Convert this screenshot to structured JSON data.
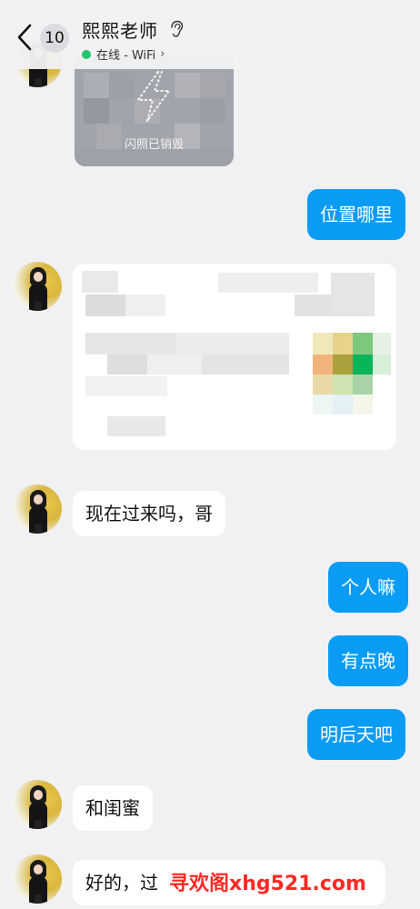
{
  "header": {
    "unread_count": "10",
    "contact_name": "熙熙老师",
    "status": "在线 - WiFi",
    "status_chevron": "›",
    "ear_icon": "ear-icon"
  },
  "flash_photo": {
    "label": "闪照已销毁"
  },
  "messages": [
    {
      "side": "out",
      "text": "位置哪里"
    },
    {
      "side": "in",
      "text": "现在过来吗，哥"
    },
    {
      "side": "out",
      "text": "个人嘛"
    },
    {
      "side": "out",
      "text": "有点晚"
    },
    {
      "side": "out",
      "text": "明后天吧"
    },
    {
      "side": "in",
      "text": "和闺蜜"
    },
    {
      "side": "in",
      "text": "好的，过"
    }
  ],
  "watermark": "寻欢阁xhg521.com",
  "colors": {
    "background": "#f1f1f4",
    "outgoing_bubble": "#0a9cf5",
    "incoming_bubble": "#ffffff",
    "online_dot": "#24c46a",
    "watermark": "#ff2a24"
  }
}
